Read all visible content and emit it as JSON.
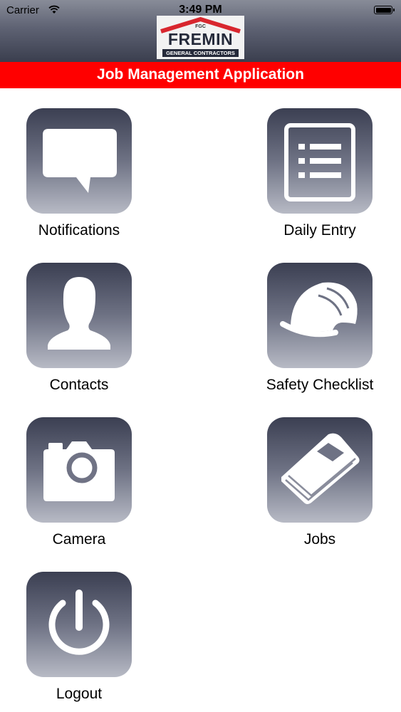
{
  "status_bar": {
    "carrier": "Carrier",
    "time": "3:49 PM"
  },
  "logo": {
    "initials": "FGC",
    "name": "FREMIN",
    "subtitle": "GENERAL CONTRACTORS"
  },
  "app_bar": {
    "title": "Job Management Application"
  },
  "tiles": [
    {
      "label": "Notifications",
      "icon": "speech-bubble-icon"
    },
    {
      "label": "Daily Entry",
      "icon": "list-document-icon"
    },
    {
      "label": "Contacts",
      "icon": "person-icon"
    },
    {
      "label": "Safety Checklist",
      "icon": "hard-hat-icon"
    },
    {
      "label": "Camera",
      "icon": "camera-icon"
    },
    {
      "label": "Jobs",
      "icon": "book-icon"
    },
    {
      "label": "Logout",
      "icon": "power-icon"
    }
  ],
  "colors": {
    "accent": "#ff0000",
    "icon_dark": "#3b3f52",
    "icon_light": "#b7bac5"
  }
}
